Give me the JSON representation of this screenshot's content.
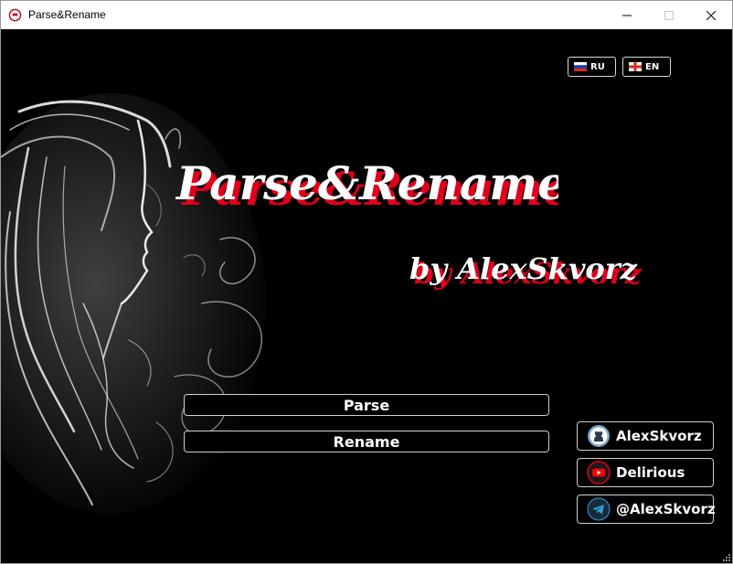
{
  "window": {
    "title": "Parse&Rename"
  },
  "language": {
    "ru_label": "RU",
    "en_label": "EN"
  },
  "logo": {
    "title": "Parse&Rename",
    "byline": "by AlexSkvorz",
    "colors": {
      "text": "#ffffff",
      "shadow": "#e0001b"
    }
  },
  "actions": {
    "parse_label": "Parse",
    "rename_label": "Rename"
  },
  "social": [
    {
      "label": "AlexSkvorz",
      "icon": "github-icon"
    },
    {
      "label": "Delirious",
      "icon": "youtube-icon"
    },
    {
      "label": "@AlexSkvorz",
      "icon": "telegram-icon"
    }
  ]
}
